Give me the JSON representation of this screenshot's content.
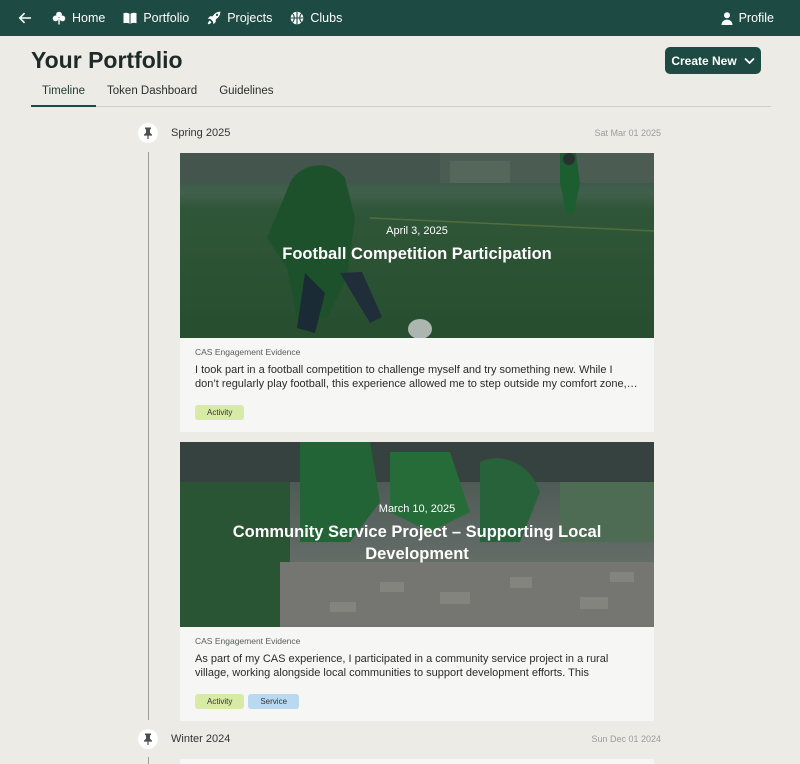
{
  "nav": {
    "items": [
      {
        "label": "Home",
        "icon": "clover-icon"
      },
      {
        "label": "Portfolio",
        "icon": "book-icon"
      },
      {
        "label": "Projects",
        "icon": "rocket-icon"
      },
      {
        "label": "Clubs",
        "icon": "basketball-icon"
      }
    ],
    "profile": "Profile"
  },
  "page": {
    "title": "Your Portfolio",
    "create_label": "Create New",
    "tabs": [
      "Timeline",
      "Token Dashboard",
      "Guidelines"
    ]
  },
  "timeline": [
    {
      "season": "Spring 2025",
      "date": "Sat Mar 01 2025",
      "entries": [
        {
          "date": "April 3, 2025",
          "title": "Football Competition Participation",
          "category": "CAS Engagement Evidence",
          "description": "I took part in a football competition to challenge myself and try something new. While I don’t regularly play football, this experience allowed me to step outside my comfort zone,…",
          "tags": [
            "Activity"
          ]
        },
        {
          "date": "March 10, 2025",
          "title": "Community Service Project – Supporting Local Development",
          "category": "CAS Engagement Evidence",
          "description": "As part of my CAS experience, I participated in a community service project in a rural village, working alongside local communities to support development efforts. This experience…",
          "tags": [
            "Activity",
            "Service"
          ]
        }
      ]
    },
    {
      "season": "Winter 2024",
      "date": "Sun Dec 01 2024",
      "entries": []
    }
  ],
  "colors": {
    "brand": "#1d4a42",
    "background": "#ecebe6",
    "activity": "#d7eaa6",
    "service": "#b9d8f2"
  }
}
